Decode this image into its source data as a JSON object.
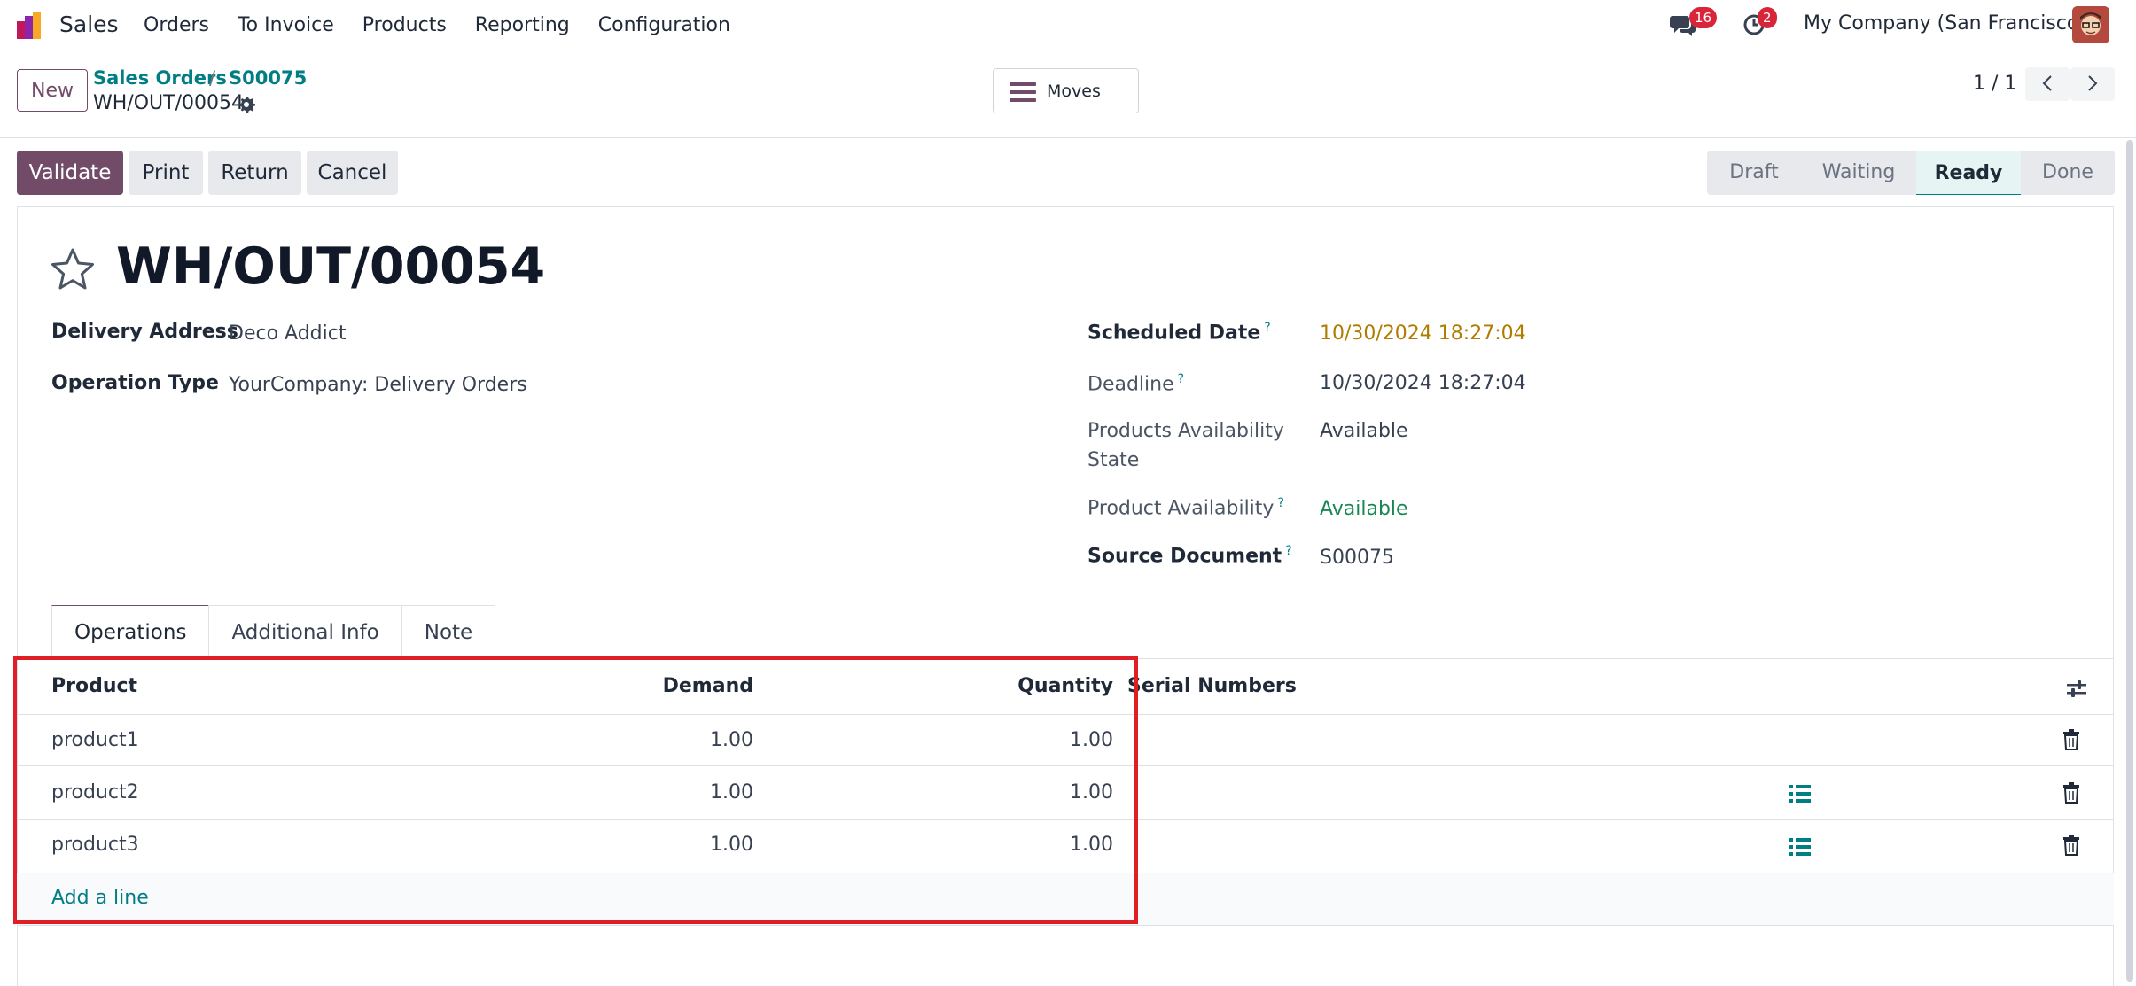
{
  "navbar": {
    "app_name": "Sales",
    "menu": [
      "Orders",
      "To Invoice",
      "Products",
      "Reporting",
      "Configuration"
    ],
    "messages_count": "16",
    "activities_count": "2",
    "company": "My Company (San Francisco)"
  },
  "control": {
    "new_label": "New",
    "breadcrumb": [
      "Sales Orders",
      "S00075"
    ],
    "breadcrumb_sep": "/",
    "current": "WH/OUT/00054",
    "moves_label": "Moves",
    "pager": "1 / 1"
  },
  "actions": {
    "validate": "Validate",
    "print": "Print",
    "return": "Return",
    "cancel": "Cancel"
  },
  "status": {
    "stages": [
      "Draft",
      "Waiting",
      "Ready",
      "Done"
    ],
    "active": "Ready"
  },
  "record": {
    "title": "WH/OUT/00054",
    "delivery_address_label": "Delivery Address",
    "delivery_address": "Deco Addict",
    "operation_type_label": "Operation Type",
    "operation_type": "YourCompany: Delivery Orders",
    "scheduled_date_label": "Scheduled Date",
    "scheduled_date": "10/30/2024 18:27:04",
    "deadline_label": "Deadline",
    "deadline": "10/30/2024 18:27:04",
    "availability_state_label_1": "Products Availability",
    "availability_state_label_2": "State",
    "availability_state": "Available",
    "product_availability_label": "Product Availability",
    "product_availability": "Available",
    "source_document_label": "Source Document",
    "source_document": "S00075",
    "help_mark": "?"
  },
  "tabs": [
    "Operations",
    "Additional Info",
    "Note"
  ],
  "list": {
    "columns": {
      "product": "Product",
      "demand": "Demand",
      "quantity": "Quantity",
      "serials": "Serial Numbers"
    },
    "rows": [
      {
        "product": "product1",
        "demand": "1.00",
        "quantity": "1.00"
      },
      {
        "product": "product2",
        "demand": "1.00",
        "quantity": "1.00"
      },
      {
        "product": "product3",
        "demand": "1.00",
        "quantity": "1.00"
      }
    ],
    "add_line": "Add a line"
  },
  "colors": {
    "brand": "#714b67",
    "link": "#017e84",
    "date_warning": "#b07c00",
    "success": "#198754",
    "highlight": "#e01e26"
  }
}
